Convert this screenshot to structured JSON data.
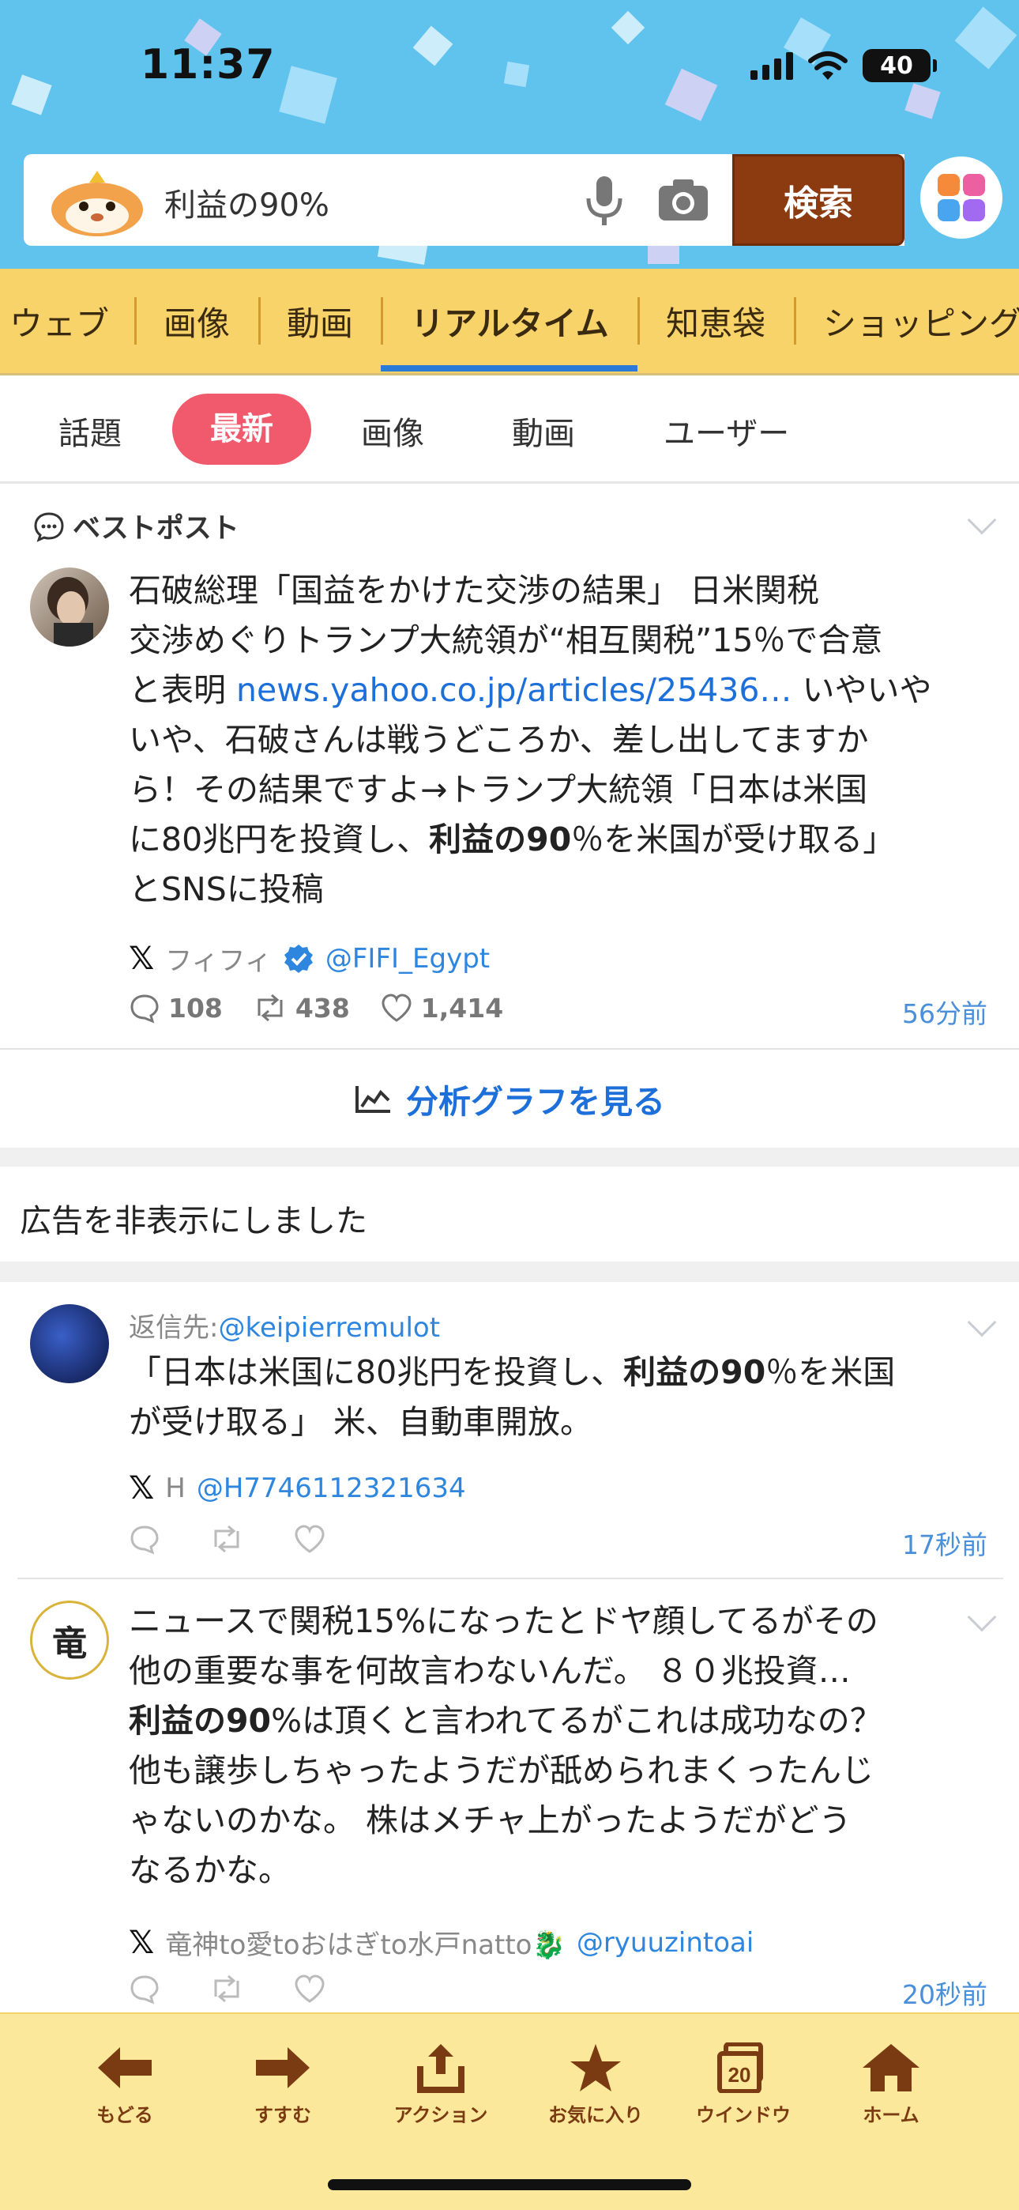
{
  "status": {
    "time": "11:37",
    "battery": "40"
  },
  "search": {
    "query": "利益の90%",
    "button": "検索"
  },
  "category_tabs": [
    "ウェブ",
    "画像",
    "動画",
    "リアルタイム",
    "知恵袋",
    "ショッピング"
  ],
  "sub_tabs": [
    "話題",
    "最新",
    "画像",
    "動画",
    "ユーザー"
  ],
  "best_post": {
    "section_label": "ベストポスト",
    "lines": [
      {
        "segments": [
          {
            "t": "石破総理「国益をかけた交渉の結果」 日米関税"
          }
        ]
      },
      {
        "segments": [
          {
            "t": "交渉めぐりトランプ大統領が“相互関税”15％で合意"
          }
        ]
      },
      {
        "segments": [
          {
            "t": "と表明 "
          },
          {
            "t": "news.yahoo.co.jp/articles/25436…",
            "link": true
          },
          {
            "t": " いやいや"
          }
        ]
      },
      {
        "segments": [
          {
            "t": "いや、石破さんは戦うどころか、差し出してますか"
          }
        ]
      },
      {
        "segments": [
          {
            "t": "ら！その結果ですよ→トランプ大統領「日本は米国"
          }
        ]
      },
      {
        "segments": [
          {
            "t": "に80兆円を投資し、"
          },
          {
            "t": "利益の90",
            "bold": true
          },
          {
            "t": "％を米国が受け取る」"
          }
        ]
      },
      {
        "segments": [
          {
            "t": "とSNSに投稿"
          }
        ]
      }
    ],
    "author_name": "フィフィ",
    "author_handle": "@FIFI_Egypt",
    "replies": "108",
    "reposts": "438",
    "likes": "1,414",
    "time": "56分前",
    "analytics_link": "分析グラフを見る"
  },
  "ad_notice": "広告を非表示にしました",
  "post2": {
    "reply_to_label": "返信先:",
    "reply_to_handle": "@keipierremulot",
    "lines": [
      {
        "segments": [
          {
            "t": "「日本は米国に80兆円を投資し、"
          },
          {
            "t": "利益の90",
            "bold": true
          },
          {
            "t": "％を米国"
          }
        ]
      },
      {
        "segments": [
          {
            "t": "が受け取る」 米、自動車開放。"
          }
        ]
      }
    ],
    "author_name": "H",
    "author_handle": "@H7746112321634",
    "time": "17秒前"
  },
  "post3": {
    "avatar_char": "竜",
    "lines": [
      {
        "segments": [
          {
            "t": "ニュースで関税15%になったとドヤ顔してるがその"
          }
        ]
      },
      {
        "segments": [
          {
            "t": "他の重要な事を何故言わないんだ。 ８０兆投資…"
          }
        ]
      },
      {
        "segments": [
          {
            "t": "利益の90",
            "bold": true
          },
          {
            "t": "%は頂くと言われてるがこれは成功なの？"
          }
        ]
      },
      {
        "segments": [
          {
            "t": "他も譲歩しちゃったようだが舐められまくったんじ"
          }
        ]
      },
      {
        "segments": [
          {
            "t": "ゃないのかな。 株はメチャ上がったようだがどう"
          }
        ]
      },
      {
        "segments": [
          {
            "t": "なるかな。"
          }
        ]
      }
    ],
    "author_name": "竜神to愛toおはぎto水戸natto🐉",
    "author_handle": "@ryuuzintoai",
    "time": "20秒前"
  },
  "toolbar": [
    {
      "label": "もどる",
      "icon": "back-arrow-icon"
    },
    {
      "label": "すすむ",
      "icon": "forward-arrow-icon"
    },
    {
      "label": "アクション",
      "icon": "share-icon"
    },
    {
      "label": "お気に入り",
      "icon": "star-icon"
    },
    {
      "label": "ウインドウ",
      "icon": "windows-icon",
      "count": "20"
    },
    {
      "label": "ホーム",
      "icon": "home-icon"
    }
  ],
  "colors": {
    "header": "#5fc3ee",
    "tabs": "#f8d36a",
    "active_subtab": "#f05a6c",
    "search_button": "#8c3a10",
    "link": "#1d6fd9",
    "toolbar": "#fbe89a"
  }
}
